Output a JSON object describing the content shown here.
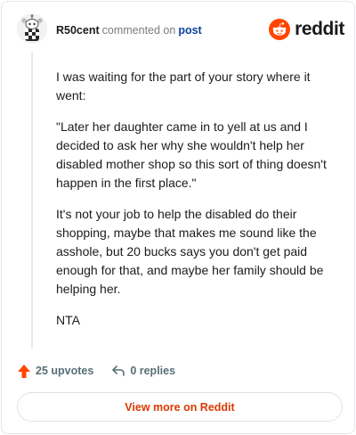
{
  "header": {
    "username": "R50cent",
    "action_text": "commented on",
    "post_link": "post",
    "brand_word": "reddit"
  },
  "comment": {
    "paragraphs": [
      "I was waiting for the part of your story where it went:",
      "\"Later her daughter came in to yell at us and I decided to ask her why she wouldn't help her disabled mother shop so this sort of thing doesn't happen in the first place.\"",
      "It's not your job to help the disabled do their shopping, maybe that makes me sound like the asshole, but 20 bucks says you don't get paid enough for that, and maybe her family should be helping her.",
      "NTA"
    ]
  },
  "actions": {
    "upvotes": "25 upvotes",
    "replies": "0 replies"
  },
  "footer": {
    "view_more": "View more on Reddit"
  },
  "colors": {
    "upvote": "#ff4500",
    "brand": "#ff4500",
    "link": "#0a449b",
    "view_more": "#d93a00"
  },
  "icons": {
    "avatar": "snoo-avatar-icon",
    "brand": "reddit-logo-icon",
    "upvote": "upvote-arrow-icon",
    "reply": "reply-arrow-icon"
  }
}
